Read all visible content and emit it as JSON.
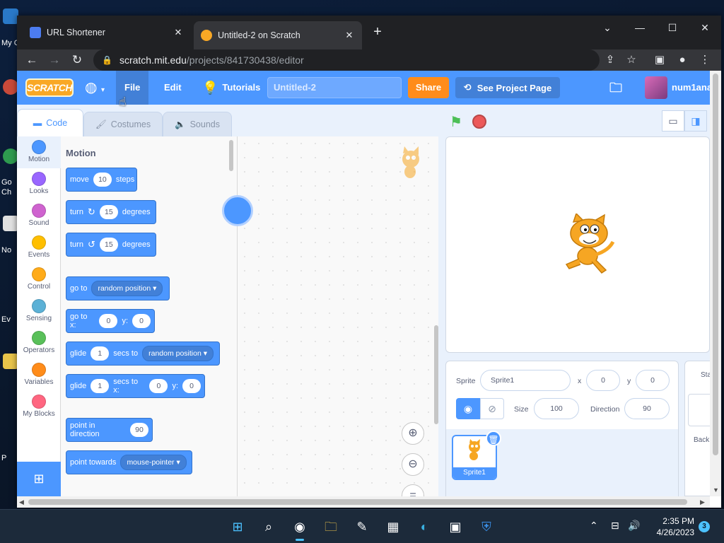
{
  "desktop": {
    "labels": [
      "My C",
      "Go",
      "Ch",
      "No",
      "Ev",
      "P"
    ]
  },
  "browser": {
    "tabs": [
      {
        "title": "URL Shortener",
        "active": false
      },
      {
        "title": "Untitled-2 on Scratch",
        "active": true
      }
    ],
    "new_tab": "+",
    "url_host": "scratch.mit.edu",
    "url_path": "/projects/841730438/editor"
  },
  "scratch": {
    "logo": "SCRATCH",
    "menu": {
      "file": "File",
      "edit": "Edit",
      "tutorials": "Tutorials",
      "project_title": "Untitled-2",
      "share": "Share",
      "see_project_page": "See Project Page",
      "username": "num1ana"
    },
    "tabs": {
      "code": "Code",
      "costumes": "Costumes",
      "sounds": "Sounds"
    },
    "categories": [
      {
        "label": "Motion",
        "color": "#4C97FF"
      },
      {
        "label": "Looks",
        "color": "#9966FF"
      },
      {
        "label": "Sound",
        "color": "#CF63CF"
      },
      {
        "label": "Events",
        "color": "#FFBF00"
      },
      {
        "label": "Control",
        "color": "#FFAB19"
      },
      {
        "label": "Sensing",
        "color": "#5CB1D6"
      },
      {
        "label": "Operators",
        "color": "#59C059"
      },
      {
        "label": "Variables",
        "color": "#FF8C1A"
      },
      {
        "label": "My Blocks",
        "color": "#FF6680"
      }
    ],
    "palette": {
      "title": "Motion",
      "blocks": {
        "move": {
          "a": "move",
          "v": "10",
          "b": "steps"
        },
        "turn_cw": {
          "a": "turn",
          "v": "15",
          "b": "degrees"
        },
        "turn_ccw": {
          "a": "turn",
          "v": "15",
          "b": "degrees"
        },
        "goto": {
          "a": "go to",
          "dd": "random position"
        },
        "gotoxy": {
          "a": "go to x:",
          "x": "0",
          "ylbl": "y:",
          "y": "0"
        },
        "glide_to": {
          "a": "glide",
          "v": "1",
          "b": "secs to",
          "dd": "random position"
        },
        "glide_xy": {
          "a": "glide",
          "v": "1",
          "b": "secs to x:",
          "x": "0",
          "ylbl": "y:",
          "y": "0"
        },
        "point_dir": {
          "a": "point in direction",
          "v": "90"
        },
        "point_towards": {
          "a": "point towards",
          "dd": "mouse-pointer"
        }
      }
    },
    "sprite_info": {
      "sprite_label": "Sprite",
      "sprite_name": "Sprite1",
      "x_label": "x",
      "x": "0",
      "y_label": "y",
      "y": "0",
      "show_label": "Show",
      "size_label": "Size",
      "size": "100",
      "direction_label": "Direction",
      "direction": "90"
    },
    "sprite_list": [
      {
        "name": "Sprite1"
      }
    ],
    "stage_pane": {
      "title": "Sta",
      "backdrops": "Back"
    }
  },
  "taskbar": {
    "time": "2:35 PM",
    "date": "4/26/2023",
    "notifications": "3"
  }
}
